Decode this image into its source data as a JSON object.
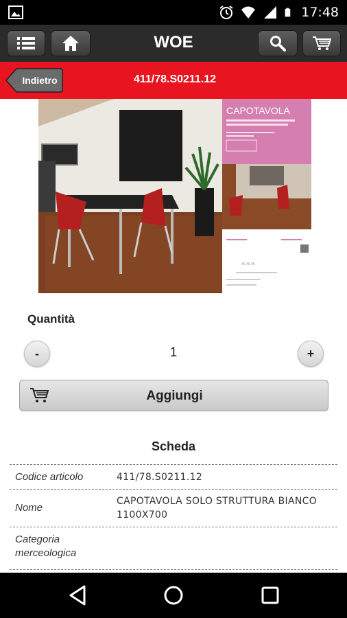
{
  "status_bar": {
    "time": "17:48",
    "icons": [
      "image-icon",
      "alarm-icon",
      "wifi-icon",
      "signal-icon",
      "battery-icon"
    ]
  },
  "header": {
    "title": "WOE",
    "buttons": [
      "menu-icon",
      "home-icon",
      "search-icon",
      "cart-icon"
    ]
  },
  "subheader": {
    "back_label": "Indietro",
    "title": "411/78.S0211.12"
  },
  "product_image": {
    "catalog_title": "CAPOTAVOLA",
    "catalog_code": "46.46.48"
  },
  "quantity": {
    "label": "Quantità",
    "minus": "-",
    "value": "1",
    "plus": "+"
  },
  "add_button": {
    "label": "Aggiungi"
  },
  "scheda": {
    "title": "Scheda",
    "rows": [
      {
        "key": "Codice articolo",
        "value": "411/78.S0211.12"
      },
      {
        "key": "Nome",
        "value": "CAPOTAVOLA SOLO STRUTTURA BIANCO 1100X700"
      },
      {
        "key": "Categoria merceologica",
        "value": ""
      }
    ]
  },
  "colors": {
    "accent_red": "#e8141f",
    "header_dark": "#2b2b2b"
  }
}
